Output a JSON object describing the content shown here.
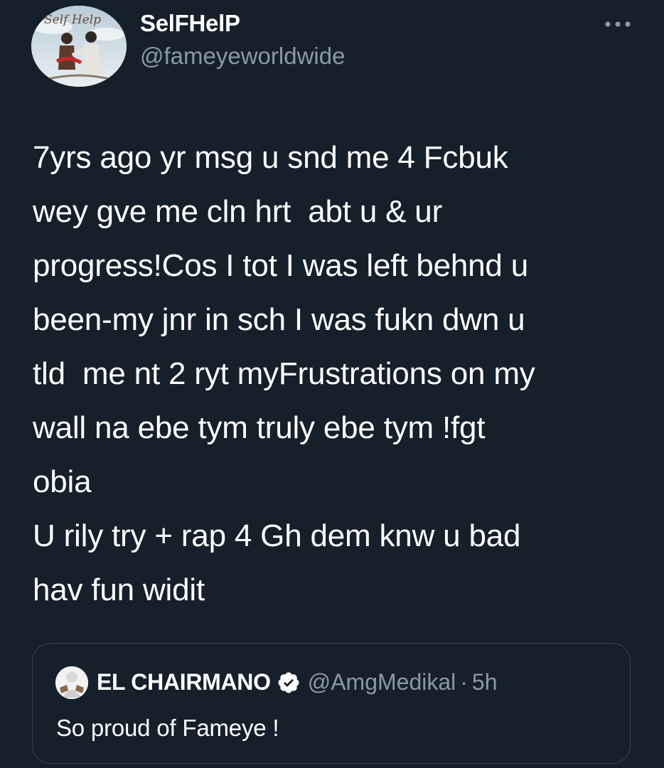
{
  "author": {
    "display_name": "SelFHelP",
    "handle": "@fameyeworldwide",
    "avatar_text": "Self Help"
  },
  "tweet": {
    "text": "7yrs ago yr msg u snd me 4 Fcbuk\nwey gve me cln hrt  abt u & ur\nprogress!Cos I tot I was left behnd u\nbeen-my jnr in sch I was fukn dwn u\ntld  me nt 2 ryt myFrustrations on my\nwall na ebe tym truly ebe tym !fgt\nobia\nU rily try + rap 4 Gh dem knw u bad\nhav fun widit"
  },
  "quoted_tweet": {
    "display_name": "EL CHAIRMANO",
    "verified_icon": "verified-badge-icon",
    "handle": "@AmgMedikal",
    "separator": "·",
    "time": "5h",
    "text": "So proud of Fameye !"
  },
  "icons": {
    "more": "more-options-icon"
  },
  "colors": {
    "background": "#15202b",
    "primary_text": "#ffffff",
    "secondary_text": "#8b98a5",
    "border": "#38444d"
  }
}
